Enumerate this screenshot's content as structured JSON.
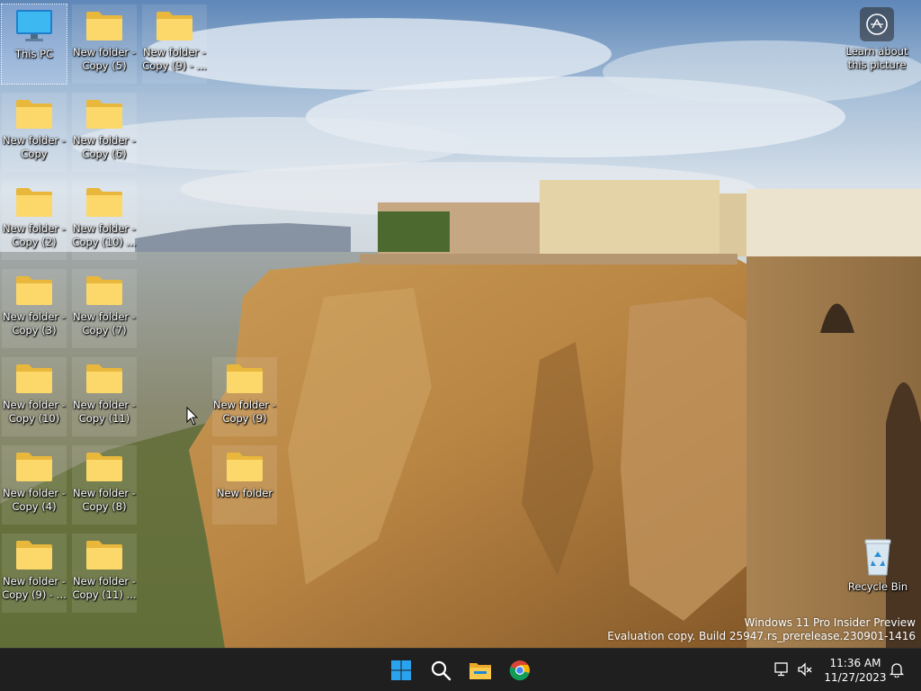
{
  "desktop": {
    "icons": [
      {
        "label": "This PC",
        "type": "this-pc",
        "selected": true
      },
      {
        "label": "New folder - Copy (5)",
        "type": "folder"
      },
      {
        "label": "New folder - Copy (9) - ...",
        "type": "folder"
      },
      {
        "label": "New folder - Copy",
        "type": "folder"
      },
      {
        "label": "New folder - Copy (6)",
        "type": "folder"
      },
      {
        "label": "New folder - Copy (2)",
        "type": "folder"
      },
      {
        "label": "New folder - Copy (10) ...",
        "type": "folder"
      },
      {
        "label": "New folder - Copy (3)",
        "type": "folder"
      },
      {
        "label": "New folder - Copy (7)",
        "type": "folder"
      },
      {
        "label": "New folder - Copy (10)",
        "type": "folder"
      },
      {
        "label": "New folder - Copy (11)",
        "type": "folder"
      },
      {
        "label": "New folder - Copy (9)",
        "type": "folder"
      },
      {
        "label": "New folder - Copy (4)",
        "type": "folder"
      },
      {
        "label": "New folder - Copy (8)",
        "type": "folder"
      },
      {
        "label": "New folder",
        "type": "folder"
      },
      {
        "label": "New folder - Copy (9) - ...",
        "type": "folder"
      },
      {
        "label": "New folder - Copy (11) ...",
        "type": "folder"
      }
    ],
    "learn_about": "Learn about this picture",
    "recycle_bin": "Recycle Bin"
  },
  "watermark": {
    "line1": "Windows 11 Pro Insider Preview",
    "line2": "Evaluation copy. Build 25947.rs_prerelease.230901-1416"
  },
  "taskbar": {
    "apps": [
      {
        "name": "start-button",
        "icon": "windows-logo-icon"
      },
      {
        "name": "search-button",
        "icon": "search-icon"
      },
      {
        "name": "file-explorer-button",
        "icon": "file-explorer-icon"
      },
      {
        "name": "chrome-button",
        "icon": "chrome-icon"
      }
    ],
    "tray": {
      "network_icon": "network-icon",
      "volume_icon": "volume-muted-icon",
      "notification_icon": "notification-bell-icon"
    },
    "clock": {
      "time": "11:36 AM",
      "date": "11/27/2023"
    }
  },
  "colors": {
    "folder_front": "#fcd86a",
    "folder_back": "#e8b73c",
    "taskbar": "#1f1f1f",
    "accent": "#0a7cd8"
  }
}
